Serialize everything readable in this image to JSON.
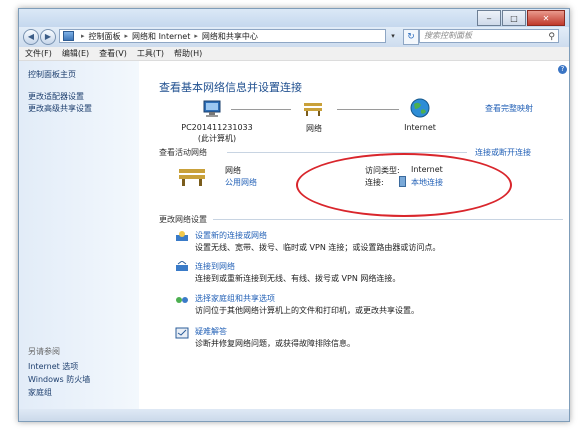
{
  "window": {
    "controls": {
      "minimize": "‒",
      "maximize": "□",
      "close": "✕"
    }
  },
  "address": {
    "crumbs": [
      "控制面板",
      "网络和 Internet",
      "网络和共享中心"
    ],
    "search_placeholder": "搜索控制面板"
  },
  "menu": [
    "文件(F)",
    "编辑(E)",
    "查看(V)",
    "工具(T)",
    "帮助(H)"
  ],
  "sidebar": {
    "links": [
      "控制面板主页",
      "更改适配器设置",
      "更改高级共享设置"
    ],
    "see_also_title": "另请参阅",
    "see_also": [
      "Internet 选项",
      "Windows 防火墙",
      "家庭组"
    ]
  },
  "main": {
    "heading": "查看基本网络信息并设置连接",
    "full_map_link": "查看完整映射",
    "map": {
      "computer_name": "PC201411231033",
      "computer_sub": "(此计算机)",
      "network": "网络",
      "internet": "Internet"
    },
    "active_section_title": "查看活动网络",
    "connect_disconnect_link": "连接或断开连接",
    "active": {
      "name": "网络",
      "type": "公用网络",
      "access_label": "访问类型:",
      "access_value": "Internet",
      "conn_label": "连接:",
      "conn_value": "本地连接"
    },
    "change_section_title": "更改网络设置",
    "tasks": [
      {
        "title": "设置新的连接或网络",
        "desc": "设置无线、宽带、拨号、临时或 VPN 连接；或设置路由器或访问点。"
      },
      {
        "title": "连接到网络",
        "desc": "连接到或重新连接到无线、有线、拨号或 VPN 网络连接。"
      },
      {
        "title": "选择家庭组和共享选项",
        "desc": "访问位于其他网络计算机上的文件和打印机，或更改共享设置。"
      },
      {
        "title": "疑难解答",
        "desc": "诊断并修复网络问题，或获得故障排除信息。"
      }
    ]
  },
  "colors": {
    "heading": "#1f4f8f",
    "link": "#2462b7",
    "highlight_ellipse": "#d9262c"
  }
}
